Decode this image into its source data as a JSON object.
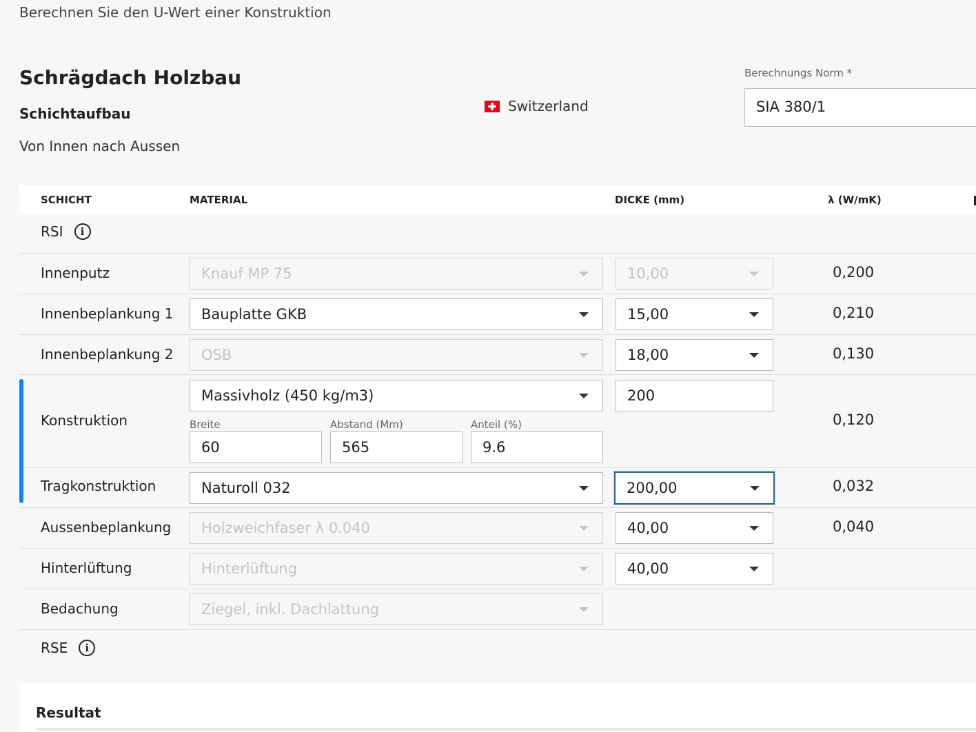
{
  "page": {
    "intro": "Berechnen Sie den U-Wert einer Konstruktion",
    "title": "Schrägdach Holzbau",
    "subtitle": "Schichtaufbau",
    "direction": "Von Innen nach Aussen",
    "country": "Switzerland",
    "norm_label": "Berechnungs Norm *",
    "norm_value": "SIA 380/1"
  },
  "table": {
    "headers": {
      "layer": "SCHICHT",
      "material": "MATERIAL",
      "thickness": "DICKE (mm)",
      "lambda": "λ (W/mK)"
    },
    "rsi": "RSI",
    "rse": "RSE",
    "rows": [
      {
        "name": "Innenputz",
        "material": "Knauf MP 75",
        "thickness": "10,00",
        "lambda": "0,200"
      },
      {
        "name": "Innenbeplankung 1",
        "material": "Bauplatte GKB",
        "thickness": "15,00",
        "lambda": "0,210"
      },
      {
        "name": "Innenbeplankung 2",
        "material": "OSB",
        "thickness": "18,00",
        "lambda": "0,130"
      },
      {
        "name": "Konstruktion",
        "material": "Massivholz (450 kg/m3)",
        "thickness": "200",
        "lambda": "0,120",
        "breite_label": "Breite",
        "breite": "60",
        "abstand_label": "Abstand (Mm)",
        "abstand": "565",
        "anteil_label": "Anteil (%)",
        "anteil": "9.6"
      },
      {
        "name": "Tragkonstruktion",
        "material": "Naturoll 032",
        "thickness": "200,00",
        "lambda": "0,032"
      },
      {
        "name": "Aussenbeplankung",
        "material": "Holzweichfaser λ 0.040",
        "thickness": "40,00",
        "lambda": "0,040"
      },
      {
        "name": "Hinterlüftung",
        "material": "Hinterlüftung",
        "thickness": "40,00",
        "lambda": ""
      },
      {
        "name": "Bedachung",
        "material": "Ziegel, inkl. Dachlattung",
        "thickness": "",
        "lambda": ""
      }
    ]
  },
  "result": {
    "title": "Resultat"
  },
  "colors": {
    "accent": "#0a84ff",
    "focus": "#2d6a82",
    "flag": "#e30613"
  },
  "icons": [
    "info-icon",
    "chevron-down-icon",
    "swiss-flag-icon"
  ]
}
